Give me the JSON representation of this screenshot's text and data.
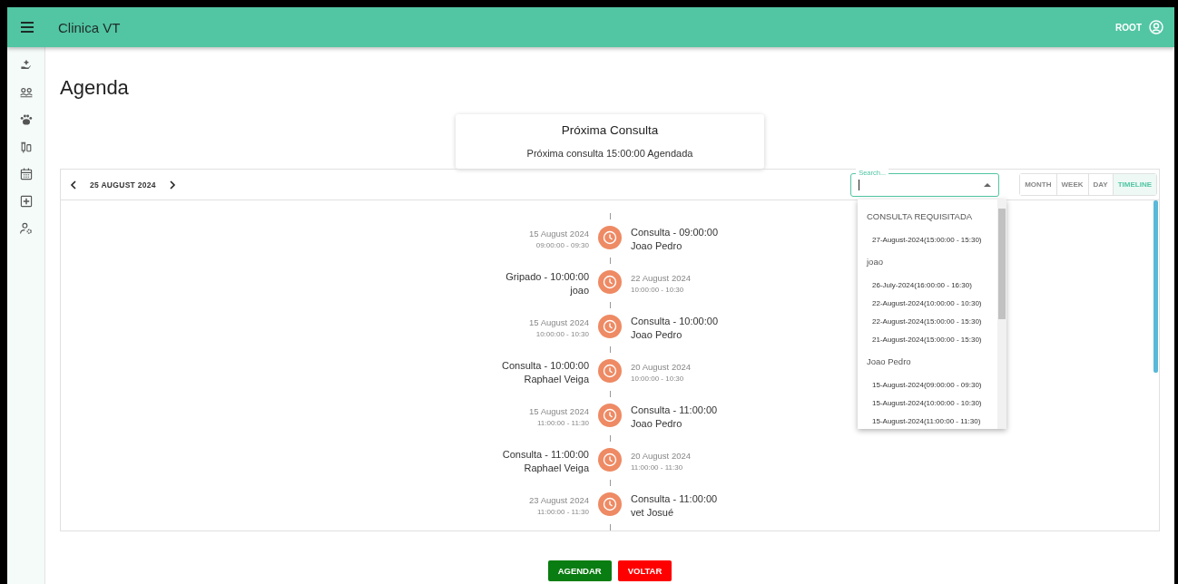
{
  "app_bar": {
    "title": "Clinica VT",
    "user": "ROOT"
  },
  "sidebar": {
    "items": [
      {
        "kind": "hand"
      },
      {
        "kind": "people"
      },
      {
        "kind": "paw"
      },
      {
        "kind": "vials"
      },
      {
        "kind": "calendar"
      },
      {
        "kind": "plus"
      },
      {
        "kind": "user-gear"
      }
    ]
  },
  "page_title": "Agenda",
  "next_card": {
    "title": "Próxima Consulta",
    "text": "Próxima consulta 15:00:00 Agendada"
  },
  "scheduler": {
    "date": "25 AUGUST 2024",
    "search": {
      "label": "Search...",
      "expanded": true
    },
    "views": [
      {
        "label": "MONTH",
        "selected": false
      },
      {
        "label": "WEEK",
        "selected": false
      },
      {
        "label": "DAY",
        "selected": false
      },
      {
        "label": "TIMELINE",
        "selected": true
      }
    ],
    "events": [
      {
        "date": "15 August 2024",
        "time": "09:00:00 - 09:30",
        "title": "Consulta - 09:00:00",
        "name": "Joao Pedro",
        "kind": "title-right"
      },
      {
        "date": "22 August 2024",
        "time": "10:00:00 - 10:30",
        "title": "Gripado - 10:00:00",
        "name": "joao",
        "kind": "title-left"
      },
      {
        "date": "15 August 2024",
        "time": "10:00:00 - 10:30",
        "title": "Consulta - 10:00:00",
        "name": "Joao Pedro",
        "kind": "title-right"
      },
      {
        "date": "20 August 2024",
        "time": "10:00:00 - 10:30",
        "title": "Consulta - 10:00:00",
        "name": "Raphael Veiga",
        "kind": "title-left"
      },
      {
        "date": "15 August 2024",
        "time": "11:00:00 - 11:30",
        "title": "Consulta - 11:00:00",
        "name": "Joao Pedro",
        "kind": "title-right"
      },
      {
        "date": "20 August 2024",
        "time": "11:00:00 - 11:30",
        "title": "Consulta - 11:00:00",
        "name": "Raphael Veiga",
        "kind": "title-left"
      },
      {
        "date": "23 August 2024",
        "time": "11:00:00 - 11:30",
        "title": "Consulta - 11:00:00",
        "name": "vet Josué",
        "kind": "title-right"
      }
    ],
    "dropdown": [
      {
        "kind": "group",
        "label": "CONSULTA REQUISITADA"
      },
      {
        "kind": "option",
        "label": "27-August-2024(15:00:00 - 15:30)"
      },
      {
        "kind": "group",
        "label": "joao"
      },
      {
        "kind": "option",
        "label": "26-July-2024(16:00:00 - 16:30)"
      },
      {
        "kind": "option",
        "label": "22-August-2024(10:00:00 - 10:30)"
      },
      {
        "kind": "option",
        "label": "22-August-2024(15:00:00 - 15:30)"
      },
      {
        "kind": "option",
        "label": "21-August-2024(15:00:00 - 15:30)"
      },
      {
        "kind": "group",
        "label": "Joao Pedro"
      },
      {
        "kind": "option",
        "label": "15-August-2024(09:00:00 - 09:30)"
      },
      {
        "kind": "option",
        "label": "15-August-2024(10:00:00 - 10:30)"
      },
      {
        "kind": "option",
        "label": "15-August-2024(11:00:00 - 11:30)"
      }
    ]
  },
  "buttons": [
    {
      "label": "AGENDAR",
      "kind": "primary"
    },
    {
      "label": "VOLTAR",
      "kind": "danger"
    }
  ]
}
